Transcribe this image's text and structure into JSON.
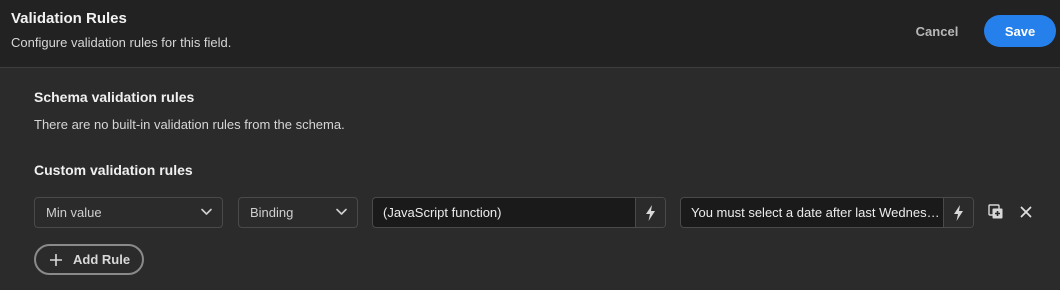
{
  "header": {
    "title": "Validation Rules",
    "subtitle": "Configure validation rules for this field.",
    "cancel_label": "Cancel",
    "save_label": "Save"
  },
  "schema_section": {
    "title": "Schema validation rules",
    "description": "There are no built-in validation rules from the schema."
  },
  "custom_section": {
    "title": "Custom validation rules",
    "rules": [
      {
        "rule_type": "Min value",
        "value_type": "Binding",
        "value": "(JavaScript function)",
        "error_message": "You must select a date after last Wednesday"
      }
    ],
    "add_rule_label": "Add Rule"
  },
  "icons": {
    "picker_arrow": "chevron-down-icon",
    "binding": "lightning-bolt-icon",
    "duplicate": "duplicate-icon",
    "delete": "close-icon",
    "add": "plus-icon"
  },
  "colors": {
    "accent": "#2680eb",
    "background": "#2b2b2b",
    "header_background": "#222222",
    "field_background": "#1a1a1a"
  }
}
